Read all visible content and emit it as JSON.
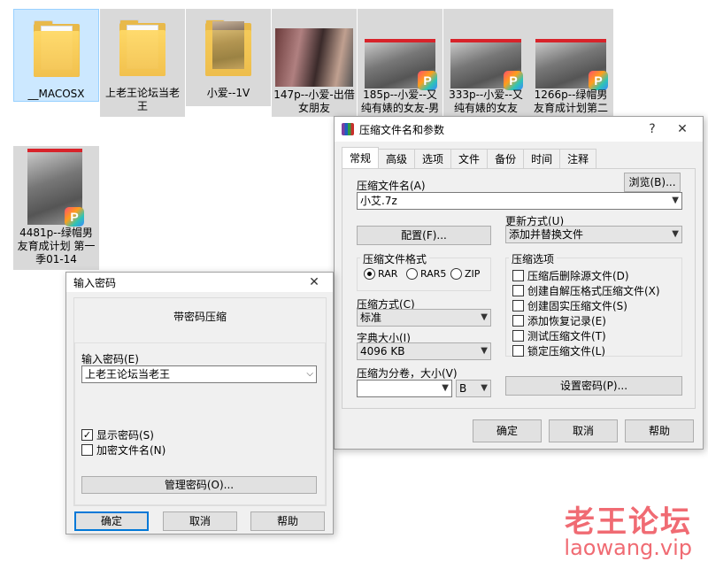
{
  "explorer": {
    "files": [
      {
        "name": "__MACOSX",
        "kind": "folder"
      },
      {
        "name": "上老王论坛当老王",
        "kind": "folder"
      },
      {
        "name": "小爱--1V",
        "kind": "folder-photo"
      },
      {
        "name": "147p--小爱-出借女朋友",
        "kind": "image"
      },
      {
        "name": "185p--小爱--又纯有婊的女友-男",
        "kind": "pdf"
      },
      {
        "name": "333p--小爱--又纯有婊的女友",
        "kind": "pdf"
      },
      {
        "name": "1266p--绿帽男友育成计划第二",
        "kind": "pdf"
      },
      {
        "name": "4481p--绿帽男友育成计划 第一季01-14",
        "kind": "pdf"
      }
    ],
    "pdf_badge": "P"
  },
  "archive_dialog": {
    "title": "压缩文件名和参数",
    "help_glyph": "?",
    "close_glyph": "✕",
    "tabs": [
      "常规",
      "高级",
      "选项",
      "文件",
      "备份",
      "时间",
      "注释"
    ],
    "archive_name_label": "压缩文件名(A)",
    "archive_name_value": "小艾.7z",
    "browse_button": "浏览(B)...",
    "profiles_button": "配置(F)...",
    "update_mode_label": "更新方式(U)",
    "update_mode_value": "添加并替换文件",
    "format_group": "压缩文件格式",
    "formats": [
      "RAR",
      "RAR5",
      "ZIP"
    ],
    "format_selected": "RAR",
    "method_label": "压缩方式(C)",
    "method_value": "标准",
    "dict_label": "字典大小(I)",
    "dict_value": "4096 KB",
    "split_label": "压缩为分卷，大小(V)",
    "split_value": "",
    "split_unit": "B",
    "options_group": "压缩选项",
    "options": [
      "压缩后删除源文件(D)",
      "创建自解压格式压缩文件(X)",
      "创建固实压缩文件(S)",
      "添加恢复记录(E)",
      "测试压缩文件(T)",
      "锁定压缩文件(L)"
    ],
    "set_password_button": "设置密码(P)...",
    "ok_button": "确定",
    "cancel_button": "取消",
    "help_button": "帮助"
  },
  "password_dialog": {
    "title": "输入密码",
    "close_glyph": "✕",
    "heading": "带密码压缩",
    "password_label": "输入密码(E)",
    "password_value": "上老王论坛当老王",
    "show_password": "显示密码(S)",
    "show_password_checked": true,
    "encrypt_names": "加密文件名(N)",
    "encrypt_names_checked": false,
    "manage_button": "管理密码(O)...",
    "ok_button": "确定",
    "cancel_button": "取消",
    "help_button": "帮助"
  },
  "watermark": {
    "line1": "老王论坛",
    "line2": "laowang.vip"
  }
}
